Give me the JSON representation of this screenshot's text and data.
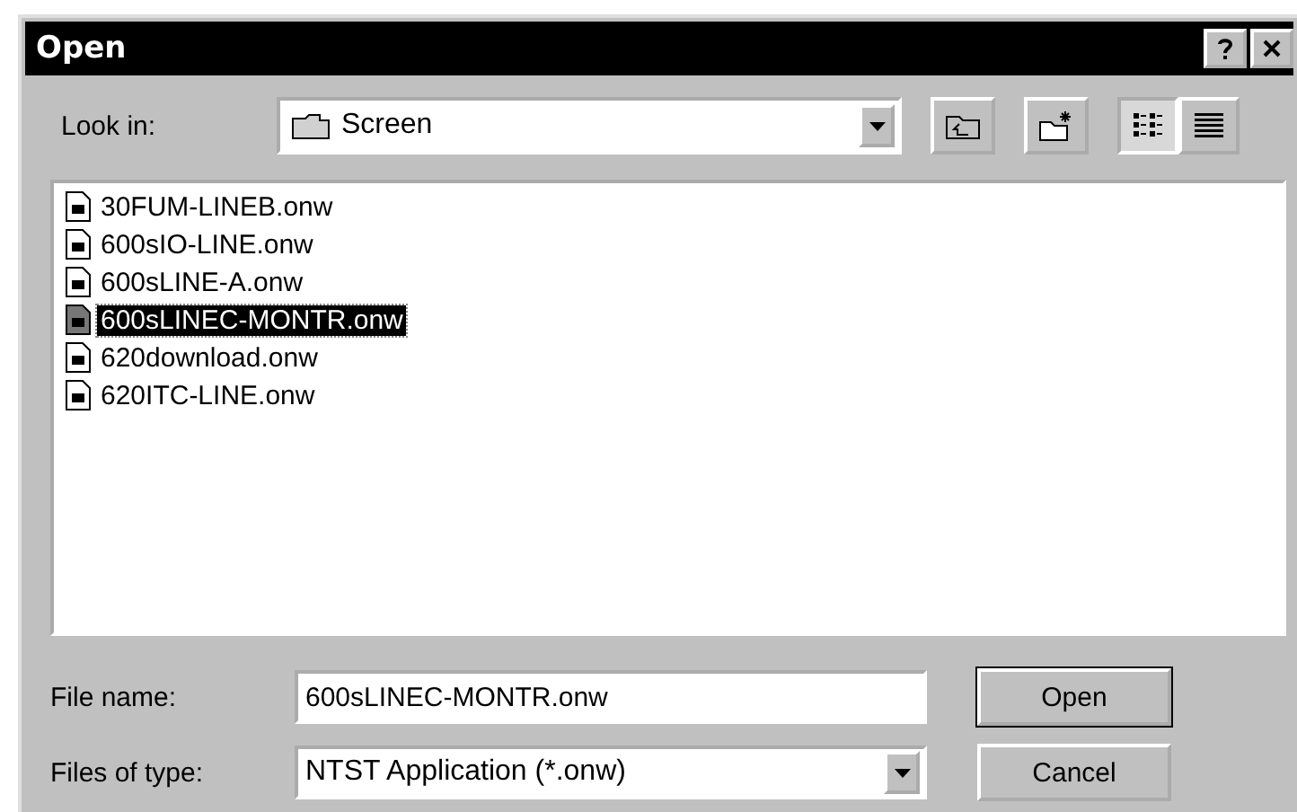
{
  "window": {
    "title": "Open"
  },
  "look_in": {
    "label": "Look in:",
    "value": "Screen"
  },
  "view_buttons": [
    {
      "kind": "list",
      "selected": true
    },
    {
      "kind": "details",
      "selected": false
    }
  ],
  "files": [
    {
      "name": "30FUM-LINEB.onw",
      "selected": false
    },
    {
      "name": "600sIO-LINE.onw",
      "selected": false
    },
    {
      "name": "600sLINE-A.onw",
      "selected": false
    },
    {
      "name": "600sLINEC-MONTR.onw",
      "selected": true
    },
    {
      "name": "620download.onw",
      "selected": false
    },
    {
      "name": "620ITC-LINE.onw",
      "selected": false
    }
  ],
  "file_name": {
    "label": "File name:",
    "value": "600sLINEC-MONTR.onw"
  },
  "file_type": {
    "label": "Files of type:",
    "value": "NTST Application (*.onw)"
  },
  "buttons": [
    "Open",
    "Cancel"
  ]
}
